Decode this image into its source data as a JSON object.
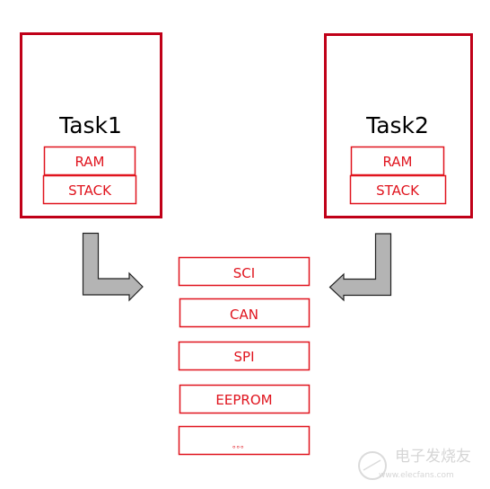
{
  "colors": {
    "task_border": "#c00018",
    "box_border": "#e0141e",
    "text": "#e0141e",
    "arrow_fill": "#b4b4b4",
    "arrow_stroke": "#222222"
  },
  "tasks": [
    {
      "title": "Task1",
      "ram": "RAM",
      "stack": "STACK"
    },
    {
      "title": "Task2",
      "ram": "RAM",
      "stack": "STACK"
    }
  ],
  "peripherals": [
    "SCI",
    "CAN",
    "SPI",
    "EEPROM",
    "。。。"
  ],
  "watermark": {
    "logo_text": "电子发烧友",
    "url": "www.elecfans.com"
  }
}
